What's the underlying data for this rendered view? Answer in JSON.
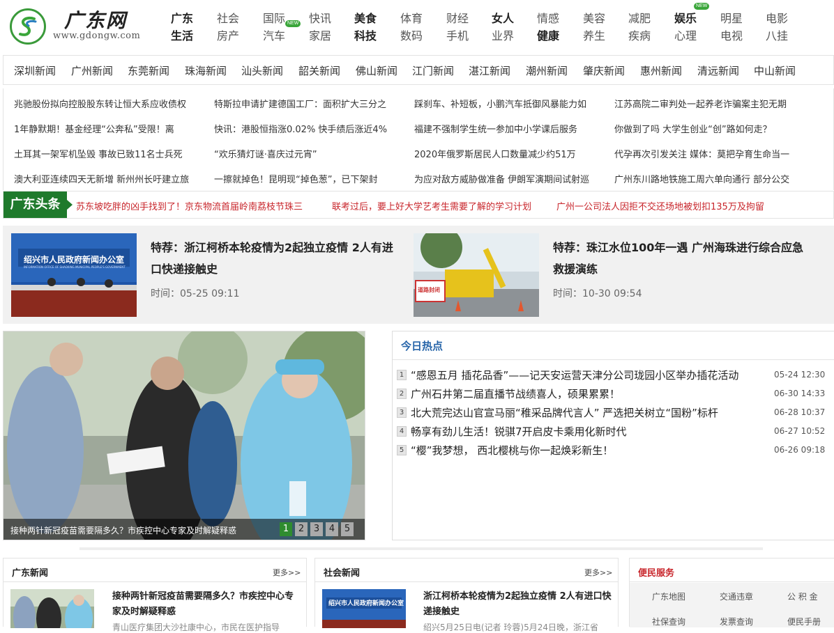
{
  "site": {
    "name": "广东网",
    "url": "www.gdongw.com"
  },
  "nav": [
    {
      "top": "广东",
      "bottom": "生活",
      "bold_top": true,
      "bold_bottom": true
    },
    {
      "top": "社会",
      "bottom": "房产"
    },
    {
      "top": "国际",
      "bottom": "汽车",
      "badge_bottom": "NEW"
    },
    {
      "top": "快讯",
      "bottom": "家居"
    },
    {
      "top": "美食",
      "bottom": "科技",
      "bold_top": true,
      "bold_bottom": true
    },
    {
      "top": "体育",
      "bottom": "数码"
    },
    {
      "top": "财经",
      "bottom": "手机"
    },
    {
      "top": "女人",
      "bottom": "业界",
      "bold_top": true
    },
    {
      "top": "情感",
      "bottom": "健康",
      "bold_bottom": true
    },
    {
      "top": "美容",
      "bottom": "养生"
    },
    {
      "top": "减肥",
      "bottom": "疾病"
    },
    {
      "top": "娱乐",
      "bottom": "心理",
      "bold_top": true,
      "badge_top": "NEW"
    },
    {
      "top": "明星",
      "bottom": "电视"
    },
    {
      "top": "电影",
      "bottom": "八挂"
    }
  ],
  "cities": [
    "深圳新闻",
    "广州新闻",
    "东莞新闻",
    "珠海新闻",
    "汕头新闻",
    "韶关新闻",
    "佛山新闻",
    "江门新闻",
    "湛江新闻",
    "潮州新闻",
    "肇庆新闻",
    "惠州新闻",
    "清远新闻",
    "中山新闻"
  ],
  "headlines": [
    [
      "兆驰股份拟向控股股东转让恒大系应收债权",
      "特斯拉申请扩建德国工厂：面积扩大三分之",
      "踩刹车、补短板，小鹏汽车抵御风暴能力如",
      "江苏高院二审判处一起养老诈骗案主犯无期"
    ],
    [
      "1年静默期！基金经理“公奔私”受限！离",
      "快讯：港股恒指涨0.02% 快手绩后涨近4%",
      "福建不强制学生统一参加中小学课后服务",
      "你做到了吗 大学生创业“创”路如何走？"
    ],
    [
      "土耳其一架军机坠毁 事故已致11名士兵死",
      "“欢乐猜灯谜·喜庆过元宵”",
      "2020年俄罗斯居民人口数量减少约51万",
      "代孕再次引发关注 媒体：莫把孕育生命当一"
    ],
    [
      "澳大利亚连续四天无新增 新州州长吁建立旅",
      "一擦就掉色！昆明现“掉色葱”，已下架封",
      "为应对敌方威胁做准备 伊朗军演期间试射巡",
      "广州东川路地铁施工周六单向通行 部分公交"
    ]
  ],
  "toutiao": {
    "label": "广东头条",
    "items": [
      "苏东坡吃胖的凶手找到了！京东物流首届岭南荔枝节珠三",
      "联考过后，要上好大学艺考生需要了解的学习计划",
      "广州一公司法人因拒不交还场地被划扣135万及拘留"
    ]
  },
  "featured": [
    {
      "prefix": "特荐：",
      "title": "浙江柯桥本轮疫情为2起独立疫情 2人有进口快递接触史",
      "time": "时间：05-25 09:11",
      "img_text": "绍兴市人民政府新闻办公室",
      "img_sub": "INFORMATION OFFICE OF SHAOXING MUNICIPAL PEOPLE'S GOVERNMENT"
    },
    {
      "prefix": "特荐：",
      "title": "珠江水位100年一遇 广州海珠进行综合应急救援演练",
      "time": "时间：10-30 09:54",
      "img_text": "道路封闭"
    }
  ],
  "slideshow": {
    "caption": "接种两针新冠疫苗需要隔多久？市疾控中心专家及时解疑释惑",
    "dots": [
      "1",
      "2",
      "3",
      "4",
      "5"
    ],
    "active": 0
  },
  "hot": {
    "title": "今日热点",
    "items": [
      {
        "n": "1",
        "text": "“感恩五月 插花品香”——记天安运营天津分公司珑园小区举办插花活动",
        "time": "05-24 12:30"
      },
      {
        "n": "2",
        "text": "广州石井第二届直播节战绩喜人，硕果累累！",
        "time": "06-30 14:33"
      },
      {
        "n": "3",
        "text": "北大荒完达山官宣马丽“稚采品牌代言人” 严选把关树立“国粉”标杆",
        "time": "06-28 10:37"
      },
      {
        "n": "4",
        "text": "畅享有劲儿生活！锐骐7开启皮卡乘用化新时代",
        "time": "06-27 10:52"
      },
      {
        "n": "5",
        "text": "“樱”我梦想， 西北樱桃与你一起焕彩新生！",
        "time": "06-26 09:18"
      }
    ]
  },
  "boxes": {
    "gd": {
      "title": "广东新闻",
      "more": "更多>>",
      "item_title": "接种两针新冠疫苗需要隔多久？市疾控中心专家及时解疑释惑",
      "item_desc": "青山医疗集团大沙社康中心，市民在医护指导"
    },
    "sh": {
      "title": "社会新闻",
      "more": "更多>>",
      "item_title": "浙江柯桥本轮疫情为2起独立疫情 2人有进口快递接触史",
      "item_desc": "绍兴5月25日电(记者 玲蓉)5月24日晚，浙江省"
    },
    "bm": {
      "title": "便民服务",
      "items": [
        "广东地图",
        "交通违章",
        "公 积 金",
        "社保查询",
        "发票查询",
        "便民手册"
      ]
    }
  },
  "colors": {
    "accent_green": "#1f7a2c",
    "headline_red": "#c8252b",
    "hot_blue": "#2765a9"
  }
}
